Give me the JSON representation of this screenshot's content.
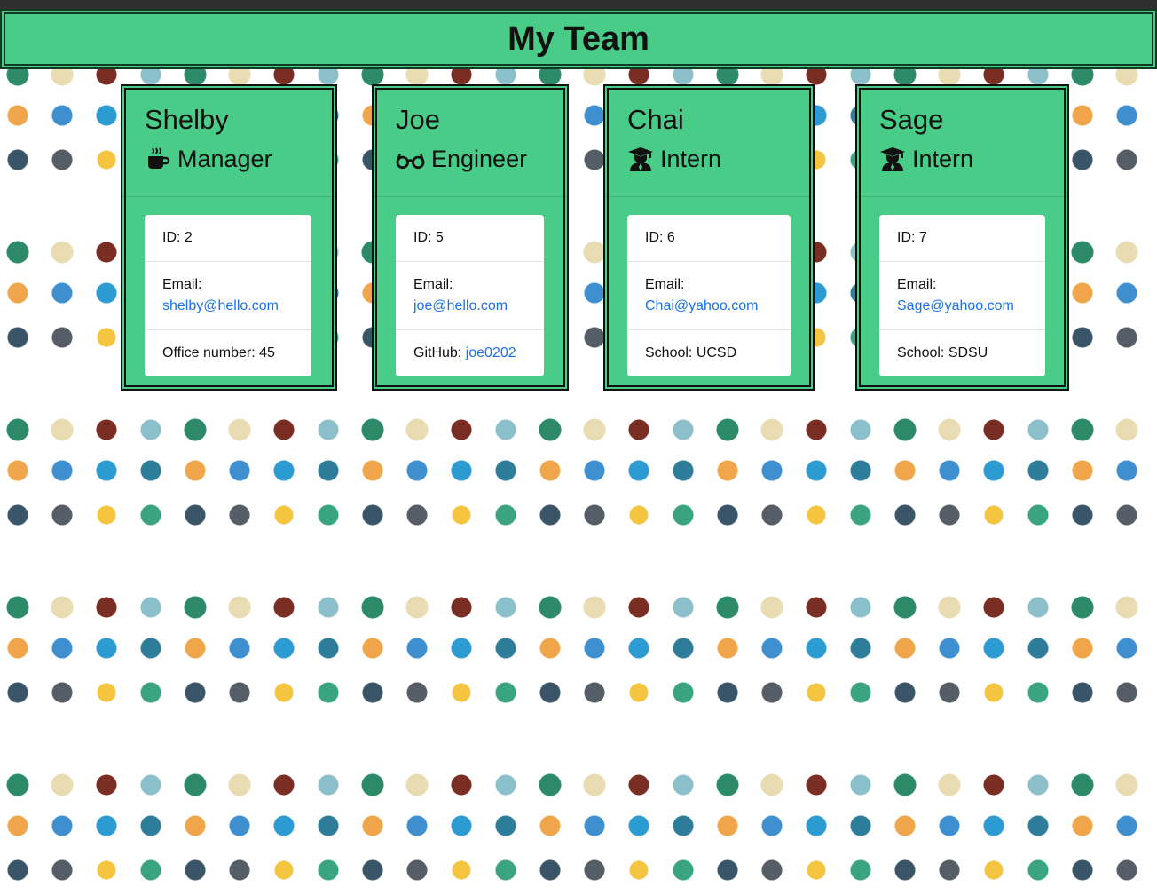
{
  "header": {
    "title": "My Team"
  },
  "team": [
    {
      "name": "Shelby",
      "role": "Manager",
      "role_icon": "coffee-icon",
      "id_text": "ID: 2",
      "email_label": "Email:",
      "email": "shelby@hello.com",
      "extra_label": "Office number: 45",
      "extra_link": ""
    },
    {
      "name": "Joe",
      "role": "Engineer",
      "role_icon": "glasses-icon",
      "id_text": "ID: 5",
      "email_label": "Email:",
      "email": "joe@hello.com",
      "extra_label": "GitHub: ",
      "extra_link": "joe0202"
    },
    {
      "name": "Chai",
      "role": "Intern",
      "role_icon": "graduate-icon",
      "id_text": "ID: 6",
      "email_label": "Email:",
      "email": "Chai@yahoo.com",
      "extra_label": "School: UCSD",
      "extra_link": ""
    },
    {
      "name": "Sage",
      "role": "Intern",
      "role_icon": "graduate-icon",
      "id_text": "ID: 7",
      "email_label": "Email:",
      "email": "Sage@yahoo.com",
      "extra_label": "School: SDSU",
      "extra_link": ""
    }
  ],
  "colors": {
    "card_bg": "#49cc88",
    "link": "#1a73e8",
    "border": "#111111"
  }
}
